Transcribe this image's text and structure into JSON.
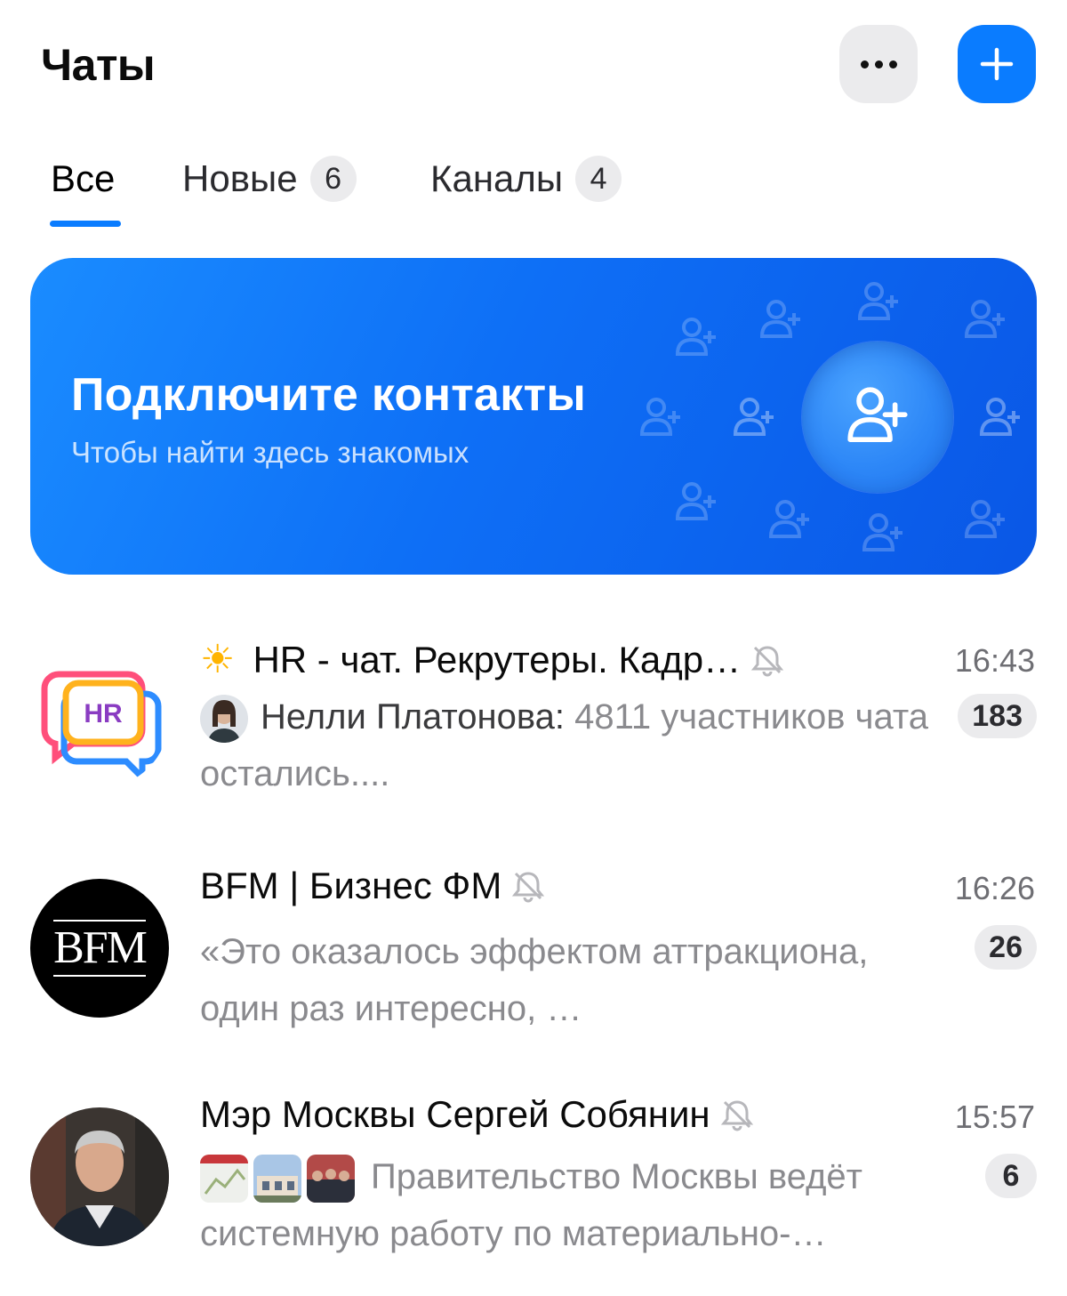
{
  "header": {
    "title": "Чаты"
  },
  "tabs": [
    {
      "label": "Все",
      "count": ""
    },
    {
      "label": "Новые",
      "count": "6"
    },
    {
      "label": "Каналы",
      "count": "4"
    }
  ],
  "banner": {
    "title": "Подключите контакты",
    "subtitle": "Чтобы найти здесь знакомых",
    "icon": "add-contact-icon"
  },
  "chats": [
    {
      "emoji": "☀",
      "name": "HR - чат. Рекрутеры. Кадр…",
      "time": "16:43",
      "sender": "Нелли Платонова:",
      "message": " 4811 участников чата остались....",
      "unread": "183",
      "muted": true,
      "avatar_label": "HR"
    },
    {
      "name": "BFM | Бизнес ФМ",
      "time": "16:26",
      "message": "«Это оказалось эффектом аттракциона, один раз интересно, …",
      "unread": "26",
      "muted": true,
      "avatar_label": "BFM"
    },
    {
      "name": "Мэр Москвы Сергей Собянин",
      "time": "15:57",
      "message": "Правительство Москвы ведёт системную работу по материально-…",
      "unread": "6",
      "muted": true
    }
  ],
  "colors": {
    "accent": "#0a7cff",
    "muted_text": "#8a8a8e",
    "badge_bg": "#ebebed"
  }
}
